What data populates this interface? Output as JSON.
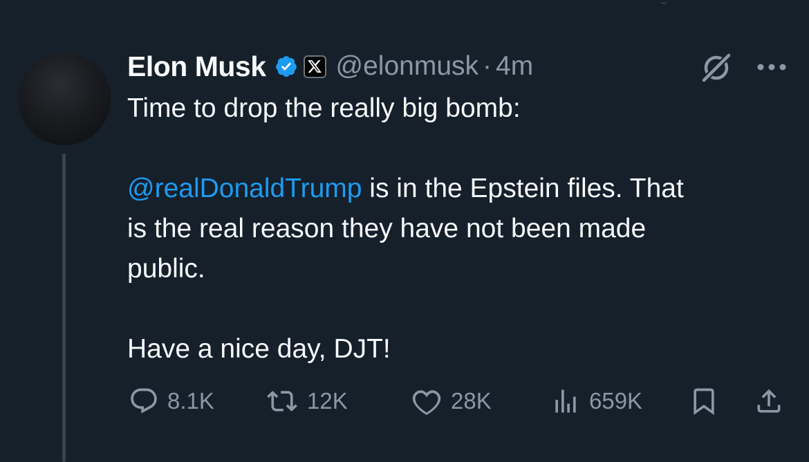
{
  "author": {
    "name": "Elon Musk",
    "handle": "@elonmusk",
    "separator": "·",
    "time": "4m"
  },
  "tweet": {
    "line1": "Time to drop the really big bomb:",
    "mention": "@realDonaldTrump",
    "line2_rest": " is in the Epstein files. That",
    "line3": "is the real reason they have not been made",
    "line4": "public.",
    "line5": "Have a nice day, DJT!"
  },
  "stats": {
    "replies": "8.1K",
    "reposts": "12K",
    "likes": "28K",
    "views": "659K"
  },
  "colors": {
    "background": "#15202b",
    "text": "#f7f9f9",
    "secondary": "#8b98a5",
    "accent": "#1d9bf0"
  },
  "icons": [
    "verified-badge-icon",
    "x-logo-icon",
    "grok-icon",
    "more-icon",
    "reply-icon",
    "repost-icon",
    "like-icon",
    "views-icon",
    "bookmark-icon",
    "share-icon"
  ]
}
